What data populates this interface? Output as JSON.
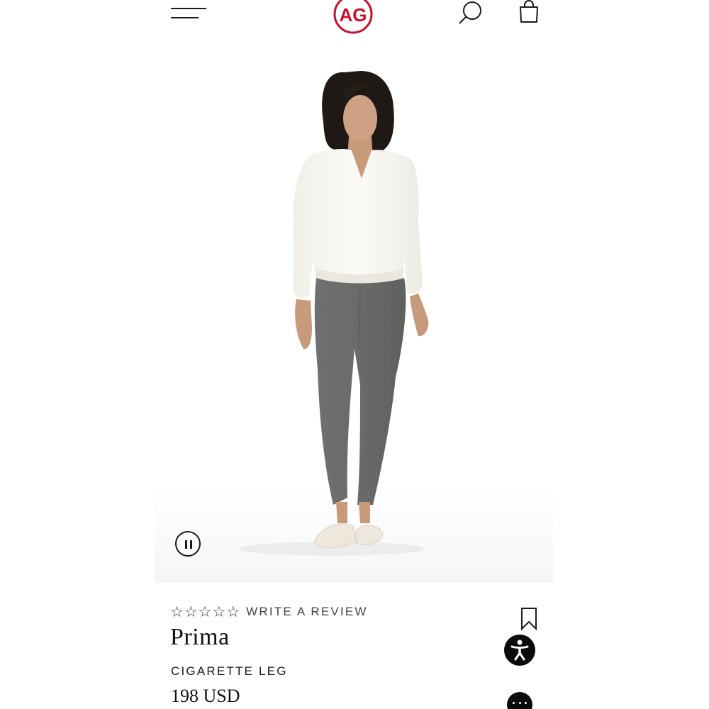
{
  "header": {
    "logo_text": "AG",
    "brand_color": "#c8102e",
    "icons": [
      "menu-icon",
      "search-icon",
      "shopping-bag-icon"
    ]
  },
  "media": {
    "state": "playing",
    "control_icon": "pause-icon"
  },
  "product": {
    "rating_stars": [
      "☆",
      "☆",
      "☆",
      "☆",
      "☆"
    ],
    "rating_value": 0,
    "review_link": "WRITE A REVIEW",
    "name": "Prima",
    "subtitle": "CIGARETTE LEG",
    "price": "198 USD"
  },
  "floating": {
    "icons": [
      "bookmark-icon",
      "accessibility-icon",
      "chat-icon"
    ]
  }
}
